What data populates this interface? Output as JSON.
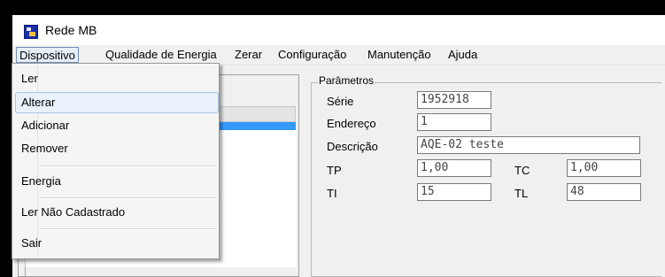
{
  "window": {
    "title": "Rede MB"
  },
  "menubar": {
    "items": [
      "Dispositivo",
      "Qualidade de Energia",
      "Zerar",
      "Configuração",
      "Manutenção",
      "Ajuda"
    ]
  },
  "dropdown": {
    "items": [
      "Ler",
      "Alterar",
      "Adicionar",
      "Remover",
      "Energia",
      "Ler Não Cadastrado",
      "Sair"
    ],
    "highlighted": "Alterar"
  },
  "parametros": {
    "title": "Parâmetros",
    "serie": {
      "label": "Série",
      "value": "1952918"
    },
    "endereco": {
      "label": "Endereço",
      "value": "1"
    },
    "descricao": {
      "label": "Descrição",
      "value": "AQE-02 teste"
    },
    "tp": {
      "label": "TP",
      "value": "1,00"
    },
    "tc": {
      "label": "TC",
      "value": "1,00"
    },
    "ti": {
      "label": "TI",
      "value": "15"
    },
    "tl": {
      "label": "TL",
      "value": "48"
    }
  },
  "colors": {
    "selection": "#3399ff",
    "menu_highlight": "#e9f1fb"
  }
}
